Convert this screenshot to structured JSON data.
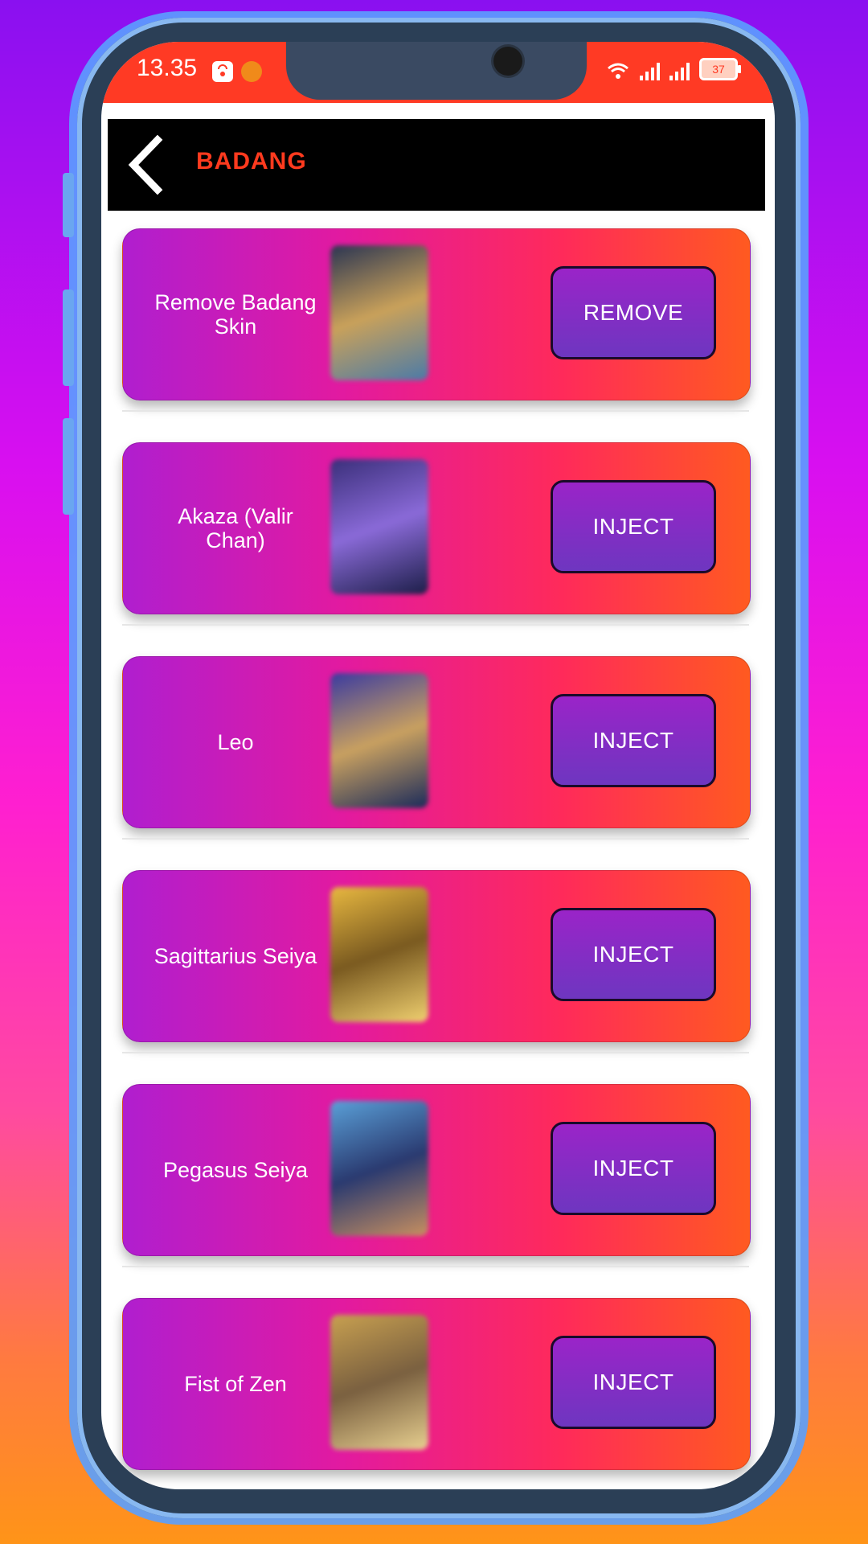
{
  "status_bar": {
    "time": "13.35",
    "battery_level": "37",
    "icons": [
      "shopping-bag-icon",
      "app-notification-icon",
      "wifi-icon",
      "signal-icon",
      "signal-icon",
      "battery-icon"
    ]
  },
  "header": {
    "back_icon": "chevron-left-icon",
    "title": "BADANG"
  },
  "items": [
    {
      "name": "Remove Badang Skin",
      "action": "REMOVE",
      "thumb_colors": [
        "#2a3552",
        "#c9a15a",
        "#4a7aa8"
      ]
    },
    {
      "name": "Akaza (Valir Chan)",
      "action": "INJECT",
      "thumb_colors": [
        "#3a2f7a",
        "#8a6ad8",
        "#1c1e48"
      ]
    },
    {
      "name": "Leo",
      "action": "INJECT",
      "thumb_colors": [
        "#3a3aa0",
        "#c8a060",
        "#1a2a5a"
      ]
    },
    {
      "name": "Sagittarius Seiya",
      "action": "INJECT",
      "thumb_colors": [
        "#e8b840",
        "#7a5a20",
        "#f0d070"
      ]
    },
    {
      "name": "Pegasus Seiya",
      "action": "INJECT",
      "thumb_colors": [
        "#5aa0d8",
        "#2a3a70",
        "#c89060"
      ]
    },
    {
      "name": "Fist of Zen",
      "action": "INJECT",
      "thumb_colors": [
        "#c8a050",
        "#7a6040",
        "#e8d090"
      ]
    }
  ],
  "colors": {
    "accent": "#ff3a24",
    "button": "#7a30c4"
  }
}
